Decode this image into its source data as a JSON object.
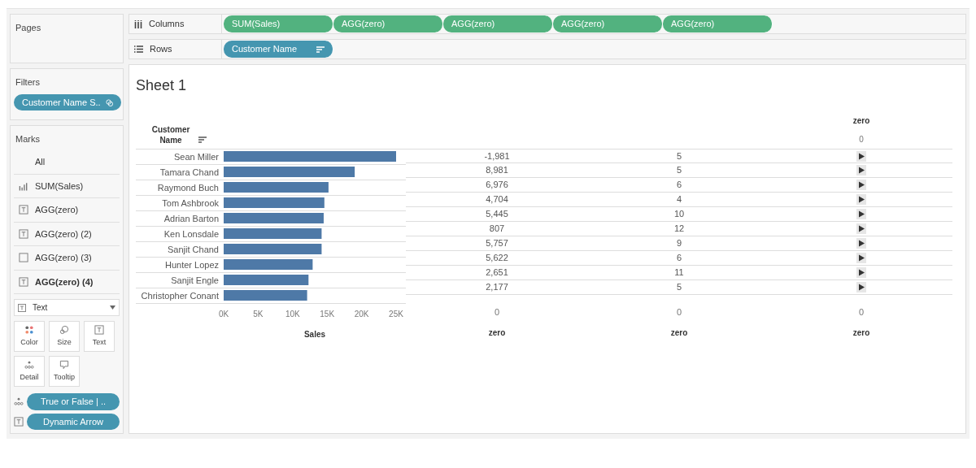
{
  "pages": {
    "title": "Pages"
  },
  "filters": {
    "title": "Filters",
    "pills": [
      {
        "label": "Customer Name S.."
      }
    ]
  },
  "marks": {
    "title": "Marks",
    "items": [
      {
        "label": "All",
        "kind": "none",
        "selected": false
      },
      {
        "label": "SUM(Sales)",
        "kind": "bar",
        "selected": false
      },
      {
        "label": "AGG(zero)",
        "kind": "text",
        "selected": false
      },
      {
        "label": "AGG(zero) (2)",
        "kind": "text",
        "selected": false
      },
      {
        "label": "AGG(zero) (3)",
        "kind": "square",
        "selected": false
      },
      {
        "label": "AGG(zero) (4)",
        "kind": "text",
        "selected": true
      }
    ],
    "mark_type": "Text",
    "cards": [
      {
        "label": "Color",
        "kind": "color"
      },
      {
        "label": "Size",
        "kind": "size"
      },
      {
        "label": "Text",
        "kind": "text"
      },
      {
        "label": "Detail",
        "kind": "detail"
      },
      {
        "label": "Tooltip",
        "kind": "tooltip"
      }
    ],
    "fields": [
      {
        "label": "True or False | ..",
        "kind": "detail"
      },
      {
        "label": "Dynamic Arrow",
        "kind": "text"
      }
    ]
  },
  "columns_shelf": {
    "title": "Columns",
    "pills": [
      "SUM(Sales)",
      "AGG(zero)",
      "AGG(zero)",
      "AGG(zero)",
      "AGG(zero)"
    ]
  },
  "rows_shelf": {
    "title": "Rows",
    "pills": [
      "Customer Name"
    ]
  },
  "sheet": {
    "title": "Sheet 1",
    "row_header": "Customer Name",
    "chart_data": {
      "type": "bar",
      "orientation": "horizontal",
      "xlabel": "Sales",
      "categories": [
        "Sean Miller",
        "Tamara Chand",
        "Raymond Buch",
        "Tom Ashbrook",
        "Adrian Barton",
        "Ken Lonsdale",
        "Sanjit Chand",
        "Hunter Lopez",
        "Sanjit Engle",
        "Christopher Conant"
      ],
      "values": [
        25000,
        19000,
        15200,
        14600,
        14500,
        14200,
        14200,
        12900,
        12300,
        12100
      ],
      "xlim": [
        0,
        26000
      ],
      "xticks": [
        {
          "value": 0,
          "label": "0K"
        },
        {
          "value": 5000,
          "label": "5K"
        },
        {
          "value": 10000,
          "label": "10K"
        },
        {
          "value": 15000,
          "label": "15K"
        },
        {
          "value": 20000,
          "label": "20K"
        },
        {
          "value": 25000,
          "label": "25K"
        }
      ]
    },
    "text_columns": [
      {
        "values": [
          "-1,981",
          "8,981",
          "6,976",
          "4,704",
          "5,445",
          "807",
          "5,757",
          "5,622",
          "2,651",
          "2,177"
        ],
        "axis_value": "0",
        "axis_label": "zero",
        "kind": "text"
      },
      {
        "values": [
          "5",
          "5",
          "6",
          "4",
          "10",
          "12",
          "9",
          "6",
          "11",
          "5"
        ],
        "axis_value": "0",
        "axis_label": "zero",
        "kind": "text"
      },
      {
        "header": "zero",
        "header_value": "0",
        "axis_value": "0",
        "axis_label": "zero",
        "kind": "arrow"
      }
    ]
  }
}
